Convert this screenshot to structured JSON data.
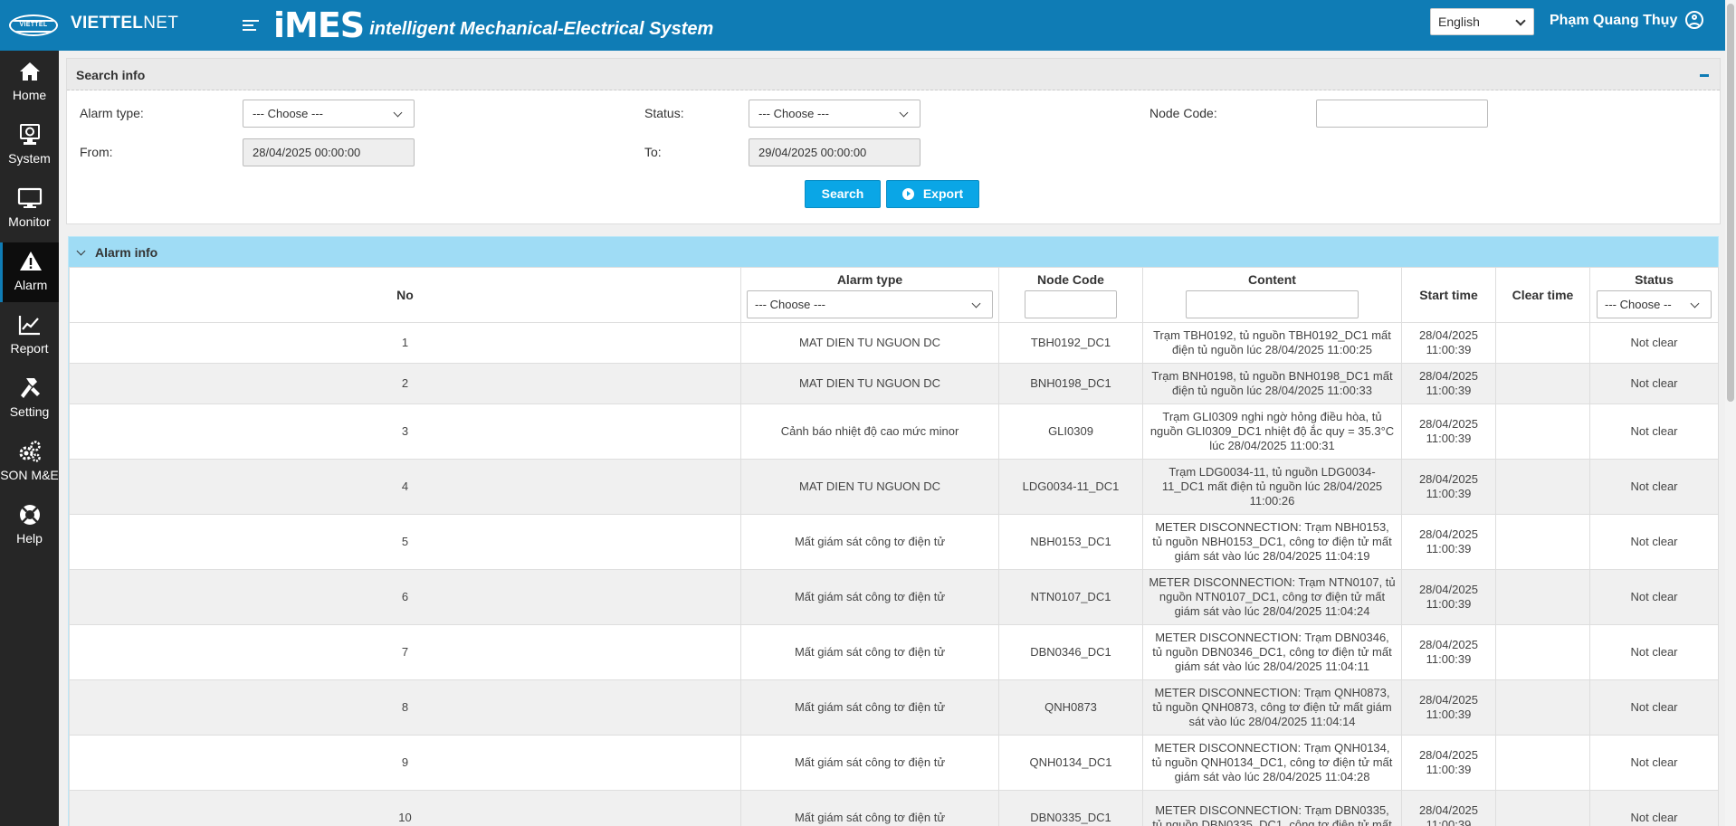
{
  "header": {
    "brand_bold": "VIETTEL",
    "brand_thin": "NET",
    "logo_text": "VIETTEL",
    "app_name": "iMES",
    "app_subtitle": "intelligent Mechanical-Electrical System",
    "language": "English",
    "username": "Phạm Quang Thụy"
  },
  "sidebar": {
    "items": [
      {
        "label": "Home",
        "icon": "home-icon"
      },
      {
        "label": "System",
        "icon": "system-icon"
      },
      {
        "label": "Monitor",
        "icon": "monitor-icon"
      },
      {
        "label": "Alarm",
        "icon": "alarm-warning-icon",
        "active": true
      },
      {
        "label": "Report",
        "icon": "report-chart-icon"
      },
      {
        "label": "Setting",
        "icon": "hammer-icon"
      },
      {
        "label": "SON M&E",
        "icon": "gears-icon"
      },
      {
        "label": "Help",
        "icon": "lifebuoy-icon"
      }
    ]
  },
  "search": {
    "title": "Search info",
    "alarm_type_label": "Alarm type:",
    "alarm_type_value": "--- Choose ---",
    "status_label": "Status:",
    "status_value": "--- Choose ---",
    "node_code_label": "Node Code:",
    "node_code_value": "",
    "from_label": "From:",
    "from_value": "28/04/2025 00:00:00",
    "to_label": "To:",
    "to_value": "29/04/2025 00:00:00",
    "search_button": "Search",
    "export_button": "Export"
  },
  "alarm": {
    "title": "Alarm info",
    "columns": {
      "no": "No",
      "alarm_type": "Alarm type",
      "node_code": "Node Code",
      "content": "Content",
      "start_time": "Start time",
      "clear_time": "Clear time",
      "status": "Status"
    },
    "filters": {
      "alarm_type": "--- Choose ---",
      "status": "--- Choose --"
    },
    "rows": [
      {
        "no": "1",
        "type": "MAT DIEN TU NGUON DC",
        "node": "TBH0192_DC1",
        "content": "Trạm TBH0192, tủ nguồn TBH0192_DC1 mất điện tủ nguồn lúc 28/04/2025 11:00:25",
        "start": "28/04/2025 11:00:39",
        "clear": "",
        "status": "Not clear"
      },
      {
        "no": "2",
        "type": "MAT DIEN TU NGUON DC",
        "node": "BNH0198_DC1",
        "content": "Trạm BNH0198, tủ nguồn BNH0198_DC1 mất điện tủ nguồn lúc 28/04/2025 11:00:33",
        "start": "28/04/2025 11:00:39",
        "clear": "",
        "status": "Not clear"
      },
      {
        "no": "3",
        "type": "Cảnh báo nhiệt độ cao mức minor",
        "node": "GLI0309",
        "content": "Trạm GLI0309 nghi ngờ hỏng điều hòa, tủ nguồn GLI0309_DC1 nhiệt độ ắc quy = 35.3°C lúc 28/04/2025 11:00:31",
        "start": "28/04/2025 11:00:39",
        "clear": "",
        "status": "Not clear"
      },
      {
        "no": "4",
        "type": "MAT DIEN TU NGUON DC",
        "node": "LDG0034-11_DC1",
        "content": "Trạm LDG0034-11, tủ nguồn LDG0034-11_DC1 mất điện tủ nguồn lúc 28/04/2025 11:00:26",
        "start": "28/04/2025 11:00:39",
        "clear": "",
        "status": "Not clear"
      },
      {
        "no": "5",
        "type": "Mất giám sát công tơ điện tử",
        "node": "NBH0153_DC1",
        "content": "METER DISCONNECTION: Trạm NBH0153, tủ nguồn NBH0153_DC1, công tơ điện tử mất giám sát vào lúc 28/04/2025 11:04:19",
        "start": "28/04/2025 11:00:39",
        "clear": "",
        "status": "Not clear"
      },
      {
        "no": "6",
        "type": "Mất giám sát công tơ điện tử",
        "node": "NTN0107_DC1",
        "content": "METER DISCONNECTION: Trạm NTN0107, tủ nguồn NTN0107_DC1, công tơ điện tử mất giám sát vào lúc 28/04/2025 11:04:24",
        "start": "28/04/2025 11:00:39",
        "clear": "",
        "status": "Not clear"
      },
      {
        "no": "7",
        "type": "Mất giám sát công tơ điện tử",
        "node": "DBN0346_DC1",
        "content": "METER DISCONNECTION: Trạm DBN0346, tủ nguồn DBN0346_DC1, công tơ điện tử mất giám sát vào lúc 28/04/2025 11:04:11",
        "start": "28/04/2025 11:00:39",
        "clear": "",
        "status": "Not clear"
      },
      {
        "no": "8",
        "type": "Mất giám sát công tơ điện tử",
        "node": "QNH0873",
        "content": "METER DISCONNECTION: Trạm QNH0873, tủ nguồn QNH0873, công tơ điện tử mất giám sát vào lúc 28/04/2025 11:04:14",
        "start": "28/04/2025 11:00:39",
        "clear": "",
        "status": "Not clear"
      },
      {
        "no": "9",
        "type": "Mất giám sát công tơ điện tử",
        "node": "QNH0134_DC1",
        "content": "METER DISCONNECTION: Trạm QNH0134, tủ nguồn QNH0134_DC1, công tơ điện tử mất giám sát vào lúc 28/04/2025 11:04:28",
        "start": "28/04/2025 11:00:39",
        "clear": "",
        "status": "Not clear"
      },
      {
        "no": "10",
        "type": "Mất giám sát công tơ điện tử",
        "node": "DBN0335_DC1",
        "content": "METER DISCONNECTION: Trạm DBN0335, tủ nguồn DBN0335_DC1, công tơ điện tử mất",
        "start": "28/04/2025 11:00:39",
        "clear": "",
        "status": "Not clear"
      }
    ]
  },
  "colors": {
    "header_bg": "#0f7cb5",
    "sidebar_bg": "#262626",
    "button_bg": "#0aa6e6",
    "alarm_head_bg": "#9fdcf5"
  }
}
